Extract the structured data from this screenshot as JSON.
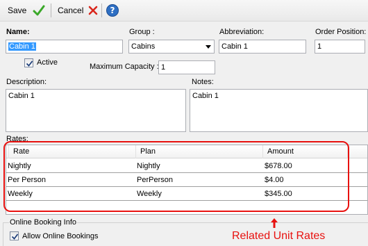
{
  "toolbar": {
    "save_label": "Save",
    "cancel_label": "Cancel"
  },
  "form": {
    "name_label": "Name:",
    "name_value": "Cabin 1",
    "group_label": "Group :",
    "group_value": "Cabins",
    "abbreviation_label": "Abbreviation:",
    "abbreviation_value": "Cabin 1",
    "order_position_label": "Order Position:",
    "order_position_value": "1",
    "active_label": "Active",
    "active_checked": true,
    "max_capacity_label": "Maximum Capacity :",
    "max_capacity_value": "1",
    "description_label": "Description:",
    "description_value": "Cabin 1",
    "notes_label": "Notes:",
    "notes_value": "Cabin 1"
  },
  "rates": {
    "label": "Rates:",
    "columns": [
      "Rate",
      "Plan",
      "Amount"
    ],
    "rows": [
      {
        "rate": "Nightly",
        "plan": "Nightly",
        "amount": "$678.00"
      },
      {
        "rate": "Per Person",
        "plan": "PerPerson",
        "amount": "$4.00"
      },
      {
        "rate": "Weekly",
        "plan": "Weekly",
        "amount": "$345.00"
      }
    ]
  },
  "online_booking": {
    "group_label": "Online Booking Info",
    "allow_label": "Allow Online Bookings",
    "allow_checked": true
  },
  "annotation": {
    "text": "Related Unit Rates",
    "color": "#e8110f"
  },
  "icons": {
    "save": "green-check-icon",
    "cancel": "red-x-icon",
    "help": "help-icon"
  }
}
